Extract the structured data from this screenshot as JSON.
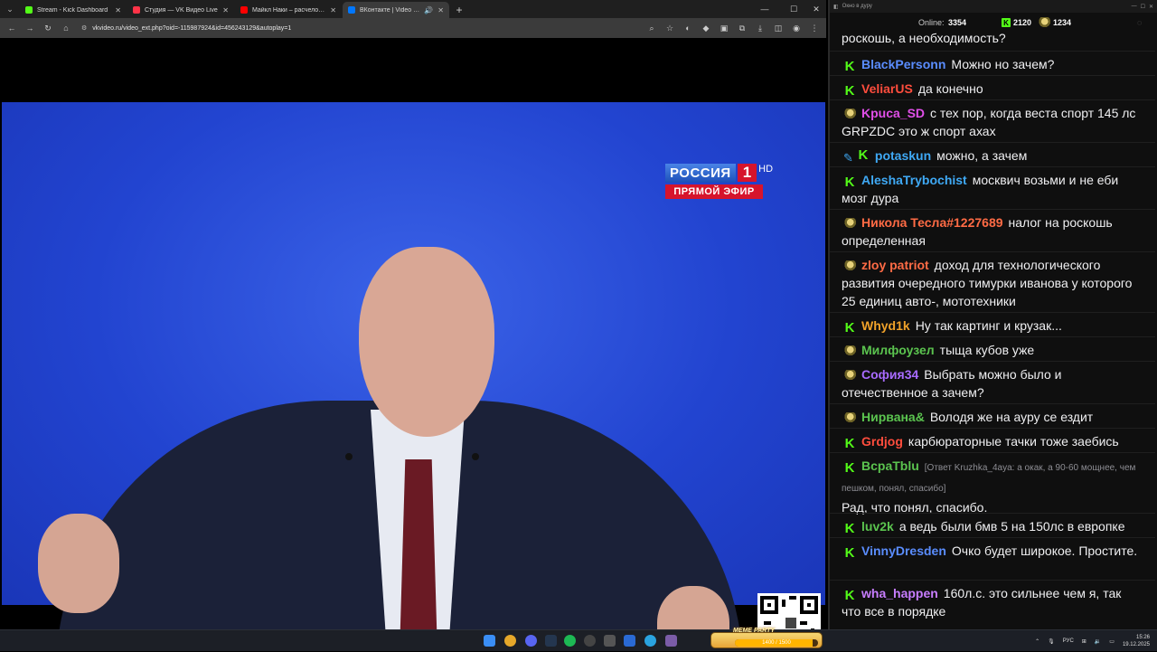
{
  "browser": {
    "tabs": [
      {
        "title": "Stream - Kick Dashboard",
        "color": "#53fc18",
        "active": false
      },
      {
        "title": "Студия — VK Видео Live",
        "color": "#ff3347",
        "active": false
      },
      {
        "title": "Майкл Наки – расчеловечивание",
        "color": "#ff0000",
        "active": false
      },
      {
        "title": "ВКонтакте | Video Ext",
        "color": "#0077ff",
        "active": true
      }
    ],
    "url": "vkvideo.ru/video_ext.php?oid=-115987924&id=456243129&autoplay=1"
  },
  "video": {
    "channel_logo": "РОССИЯ",
    "channel_number": "1",
    "channel_hd": "HD",
    "live_label": "ПРЯМОЙ ЭФИР"
  },
  "chat": {
    "window_title": "Окно в дуру",
    "online_label": "Online:",
    "online_count": "3354",
    "kick_count": "2120",
    "emote_count": "1234",
    "top_fragment": "роскошь, а необходимость?",
    "messages": [
      {
        "badges": [
          "kick"
        ],
        "user": "BlackPersonn",
        "color": "#5a8dff",
        "text": "Можно но зачем?"
      },
      {
        "badges": [
          "kick"
        ],
        "user": "VeliarUS",
        "color": "#ff4d3d",
        "text": "да конечно"
      },
      {
        "badges": [
          "emote"
        ],
        "user": "Kpuca_SD",
        "color": "#e04fe8",
        "text": "с тех пор, когда веста спорт 145 лс GRPZDC  это ж спорт ахах"
      },
      {
        "badges": [
          "pin",
          "kick"
        ],
        "user": "potaskun",
        "color": "#3fa9f5",
        "text": "можно, а зачем"
      },
      {
        "badges": [
          "kick"
        ],
        "user": "AleshaTrybochist",
        "color": "#3fa9f5",
        "text": "москвич возьми и не еби мозг дура"
      },
      {
        "badges": [
          "emote"
        ],
        "user": "Никола Тесла#1227689",
        "color": "#ff6b45",
        "text": "налог на роскошь определенная"
      },
      {
        "badges": [
          "emote"
        ],
        "user": "zloy patriot",
        "color": "#ff6b45",
        "text": "доход для технологического развития очередного тимурки иванова у которого 25 единиц авто-, мототехники"
      },
      {
        "badges": [
          "kick"
        ],
        "user": "Whyd1k",
        "color": "#f0a22a",
        "text": "Ну так картинг и крузак..."
      },
      {
        "badges": [
          "emote"
        ],
        "user": "Милфоузел",
        "color": "#5bc44f",
        "text": "тыща кубов уже"
      },
      {
        "badges": [
          "emote"
        ],
        "user": "София34",
        "color": "#a86bff",
        "text": "Выбрать можно было и отечественное а зачем?"
      },
      {
        "badges": [
          "emote"
        ],
        "user": "Нирвана&",
        "color": "#5bc44f",
        "text": "Володя же на ауру се ездит"
      },
      {
        "badges": [
          "kick"
        ],
        "user": "Grdjog",
        "color": "#ff4d3d",
        "text": "карбюраторные тачки тоже заебись"
      },
      {
        "badges": [
          "kick"
        ],
        "user": "BcpaTblu",
        "color": "#5bc44f",
        "reply": "[Ответ Kruzhka_4aya: а окак, а 90-60 мощнее, чем пешком, понял, спасибо]",
        "text": "Рад, что понял, спасибо."
      },
      {
        "badges": [
          "kick"
        ],
        "user": "luv2k",
        "color": "#5bc44f",
        "text": "а ведь были бмв 5 на 150лс в европке"
      },
      {
        "badges": [
          "kick"
        ],
        "user": "VinnyDresden",
        "color": "#5a8dff",
        "text": "Очко будет широкое. Простите."
      },
      {
        "badges": [
          "kick"
        ],
        "user": "wha_happen",
        "color": "#c77dff",
        "text": "160л.с. это сильнее чем я, так что все в порядке"
      }
    ]
  },
  "taskbar": {
    "meme_title": "MEME PARTY",
    "meme_progress_text": "1400 / 1500",
    "meme_progress": 0.93,
    "lang": "РУС",
    "time": "15:26",
    "date": "19.12.2025"
  }
}
